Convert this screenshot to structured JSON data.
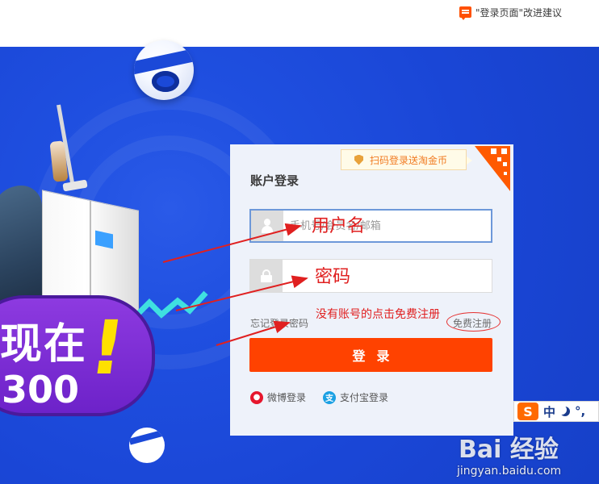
{
  "header": {
    "feedback_label": "\"登录页面\"改进建议",
    "feedback_icon": "comment-icon"
  },
  "banner": {
    "promo_line1": "现在",
    "promo_line2": "300",
    "promo_exclaim": "!"
  },
  "login": {
    "title": "账户登录",
    "qr_tip": "扫码登录送淘金币",
    "username_placeholder": "手机号/会员名/邮箱",
    "password_placeholder": "",
    "forgot_label": "忘记登录密码",
    "register_label": "免费注册",
    "submit_label": "登录",
    "weibo_label": "微博登录",
    "alipay_label": "支付宝登录",
    "alipay_glyph": "支"
  },
  "annotations": {
    "username": "用户名",
    "password": "密码",
    "register_hint": "没有账号的点击免费注册"
  },
  "ime": {
    "logo": "S",
    "mode": "中",
    "punct": "°,"
  },
  "watermark": {
    "logo": "Bai 经验",
    "url": "jingyan.baidu.com"
  },
  "colors": {
    "accent": "#ff4200",
    "banner_blue": "#1a46d6",
    "annotation_red": "#e02020"
  }
}
